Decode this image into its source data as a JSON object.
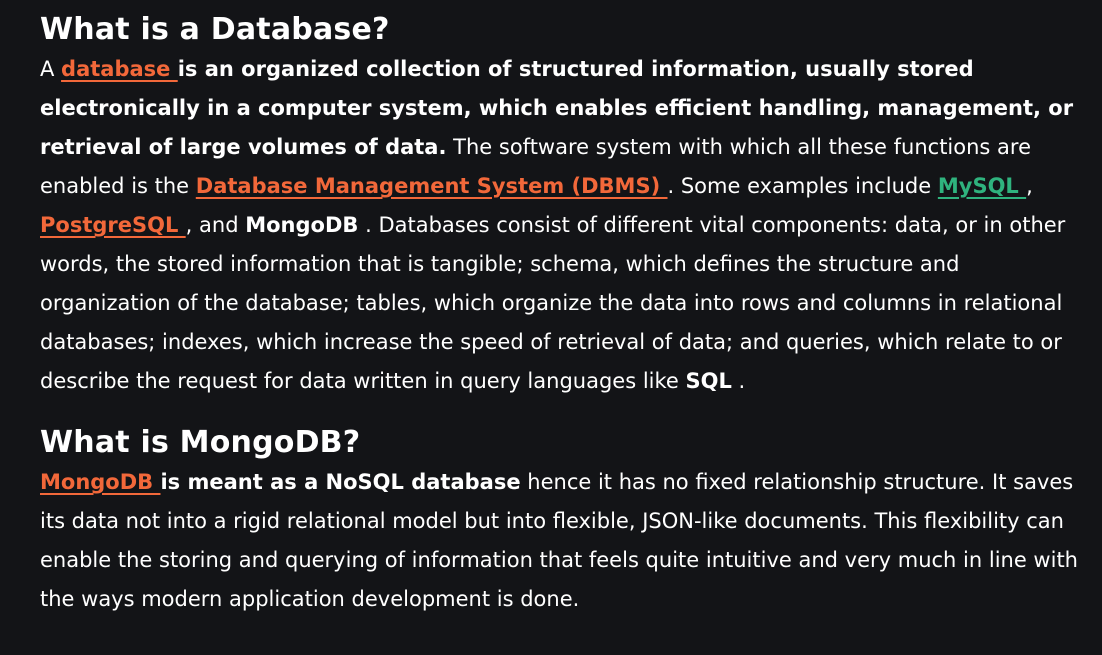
{
  "colors": {
    "background": "#131417",
    "text": "#ffffff",
    "link_orange": "#f2683a",
    "link_green": "#2fb37e"
  },
  "section1": {
    "title": "What is a Database?",
    "t_a": "A ",
    "link_database": "database ",
    "t_bold_intro": "is an organized collection of structured information, usually stored electronically in a computer system, which enables efficient handling, management, or retrieval of large volumes of data.",
    "t_b": " The software system with which all these functions are enabled is the ",
    "link_dbms": "Database Management System (DBMS) ",
    "t_c": ". Some examples include ",
    "link_mysql": "MySQL ",
    "t_d": ", ",
    "link_postgresql": "PostgreSQL ",
    "t_e": ", and ",
    "b_mongodb": "MongoDB",
    "t_f": " . Databases consist of different vital components: data, or in other words, the stored information that is tangible; schema, which defines the structure and organization of the database; tables, which organize the data into rows and columns in relational databases; indexes, which increase the speed of retrieval of data; and queries, which relate to or describe the request for data written in query languages like ",
    "b_sql": "SQL",
    "t_g": " ."
  },
  "section2": {
    "title": "What is MongoDB?",
    "link_mongodb": "MongoDB ",
    "t_bold_nosql": "is meant as a NoSQL database",
    "t_rest": " hence it has no fixed relationship structure. It saves its data not into a rigid relational model but into flexible, JSON-like documents. This flexibility can enable the storing and querying of information that feels quite intuitive and very much in line with the ways modern application development is done."
  }
}
